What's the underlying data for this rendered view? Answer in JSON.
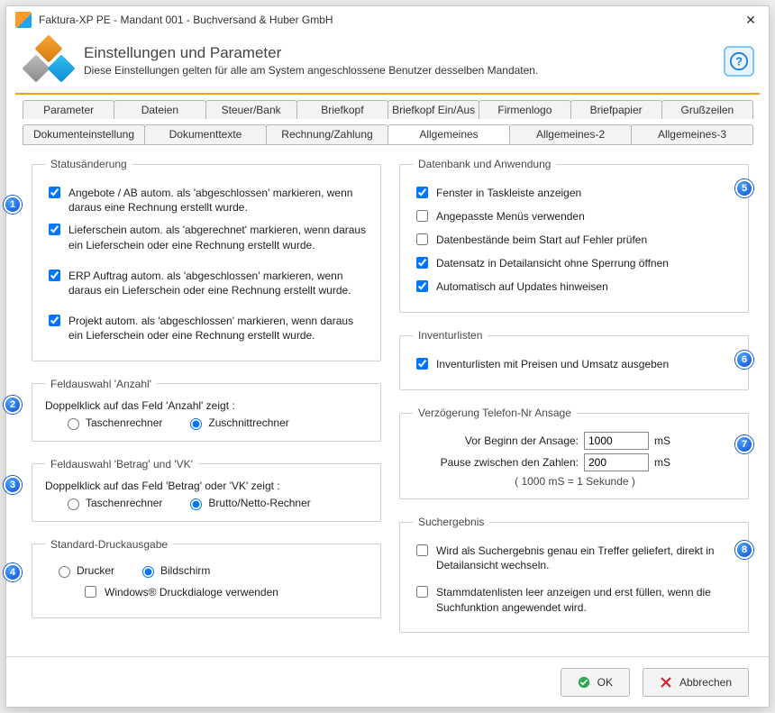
{
  "window": {
    "title": "Faktura-XP PE - Mandant 001 - Buchversand & Huber GmbH"
  },
  "header": {
    "title": "Einstellungen und Parameter",
    "subtitle": "Diese Einstellungen gelten für alle am System angeschlossene Benutzer desselben Mandaten."
  },
  "tabs_row1": [
    "Parameter",
    "Dateien",
    "Steuer/Bank",
    "Briefkopf",
    "Briefkopf Ein/Aus",
    "Firmenlogo",
    "Briefpapier",
    "Grußzeilen"
  ],
  "tabs_row2": [
    "Dokumenteinstellung",
    "Dokumenttexte",
    "Rechnung/Zahlung",
    "Allgemeines",
    "Allgemeines-2",
    "Allgemeines-3"
  ],
  "tabs_row2_selected_index": 3,
  "status": {
    "legend": "Statusänderung",
    "items": [
      {
        "label": "Angebote / AB autom. als 'abgeschlossen' markieren, wenn daraus eine Rechnung erstellt wurde.",
        "checked": true
      },
      {
        "label": "Lieferschein autom. als 'abgerechnet' markieren, wenn daraus ein Lieferschein oder eine Rechnung erstellt wurde.",
        "checked": true
      },
      {
        "label": "ERP Auftrag autom. als 'abgeschlossen' markieren, wenn daraus ein Lieferschein oder eine Rechnung erstellt wurde.",
        "checked": true
      },
      {
        "label": "Projekt autom. als 'abgeschlossen' markieren, wenn daraus  ein Lieferschein oder eine Rechnung erstellt wurde.",
        "checked": true
      }
    ]
  },
  "anzahl": {
    "legend": "Feldauswahl 'Anzahl'",
    "prompt": "Doppelklick auf das Feld 'Anzahl' zeigt :",
    "options": [
      "Taschenrechner",
      "Zuschnittrechner"
    ],
    "selected": 1
  },
  "betrag": {
    "legend": "Feldauswahl 'Betrag' und 'VK'",
    "prompt": "Doppelklick auf das Feld 'Betrag' oder 'VK' zeigt :",
    "options": [
      "Taschenrechner",
      "Brutto/Netto-Rechner"
    ],
    "selected": 1
  },
  "druck": {
    "legend": "Standard-Druckausgabe",
    "options": [
      "Drucker",
      "Bildschirm"
    ],
    "selected": 1,
    "wdialog_label": "Windows® Druckdialoge verwenden",
    "wdialog_checked": false
  },
  "db": {
    "legend": "Datenbank und Anwendung",
    "items": [
      {
        "label": "Fenster in Taskleiste anzeigen",
        "checked": true
      },
      {
        "label": "Angepasste Menüs verwenden",
        "checked": false
      },
      {
        "label": "Datenbestände beim Start auf Fehler prüfen",
        "checked": false
      },
      {
        "label": "Datensatz in Detailansicht ohne Sperrung öffnen",
        "checked": true
      },
      {
        "label": "Automatisch auf Updates hinweisen",
        "checked": true
      }
    ]
  },
  "inventur": {
    "legend": "Inventurlisten",
    "label": "Inventurlisten mit Preisen und Umsatz ausgeben",
    "checked": true
  },
  "tel": {
    "legend": "Verzögerung Telefon-Nr Ansage",
    "before_label": "Vor Beginn der Ansage:",
    "before_value": "1000",
    "between_label": "Pause zwischen den Zahlen:",
    "between_value": "200",
    "unit": "mS",
    "hint": "( 1000 mS = 1 Sekunde )"
  },
  "search": {
    "legend": "Suchergebnis",
    "items": [
      {
        "label": "Wird als Suchergebnis genau ein Treffer geliefert, direkt in Detailansicht wechseln.",
        "checked": false
      },
      {
        "label": "Stammdatenlisten leer anzeigen und erst füllen, wenn die Suchfunktion angewendet wird.",
        "checked": false
      }
    ]
  },
  "footer": {
    "ok": "OK",
    "cancel": "Abbrechen"
  },
  "badges": [
    "1",
    "2",
    "3",
    "4",
    "5",
    "6",
    "7",
    "8"
  ]
}
